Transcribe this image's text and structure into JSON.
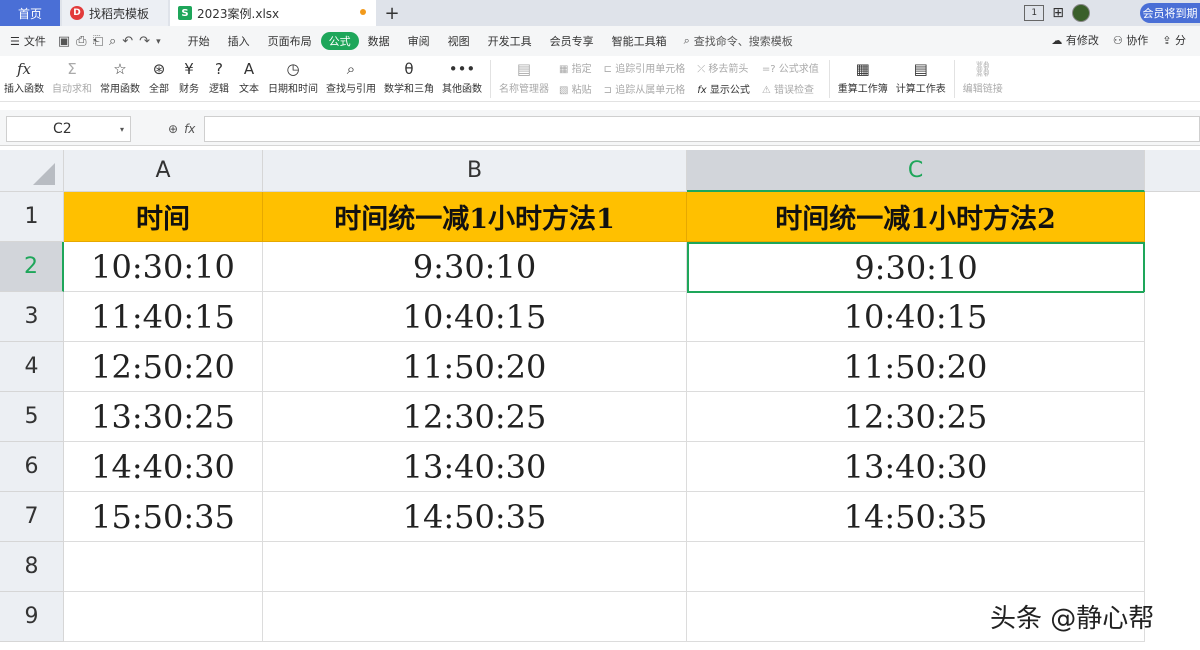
{
  "tabs": {
    "home": "首页",
    "template": "找稻壳模板",
    "file": "2023案例.xlsx",
    "add": "+"
  },
  "titlebar": {
    "page_indicator": "1",
    "vip_label": "会员将到期"
  },
  "menubar": {
    "file_label": "文件",
    "items": [
      "开始",
      "插入",
      "页面布局",
      "公式",
      "数据",
      "审阅",
      "视图",
      "开发工具",
      "会员专享",
      "智能工具箱"
    ],
    "active_index": 3,
    "search_label": "查找命令、搜索模板",
    "changes_label": "有修改",
    "collab_label": "协作",
    "share_label": "分"
  },
  "ribbon": {
    "insert_function": "插入函数",
    "auto_sum": "自动求和",
    "common_functions": "常用函数",
    "all": "全部",
    "finance": "财务",
    "logic": "逻辑",
    "text": "文本",
    "datetime": "日期和时间",
    "lookup": "查找与引用",
    "math": "数学和三角",
    "other": "其他函数",
    "name_manager": "名称管理器",
    "assign": "指定",
    "paste": "粘贴",
    "trace_precedents": "追踪引用单元格",
    "trace_dependents": "追踪从属单元格",
    "remove_arrows": "移去箭头",
    "show_formulas": "显示公式",
    "formula_eval": "公式求值",
    "error_check": "错误检查",
    "recalc_workbook": "重算工作簿",
    "calc_sheet": "计算工作表",
    "edit_links": "编辑链接"
  },
  "formula_bar": {
    "name_box": "C2",
    "fx_label": "fx",
    "formula": ""
  },
  "sheet": {
    "columns": [
      "A",
      "B",
      "C"
    ],
    "rows": [
      "1",
      "2",
      "3",
      "4",
      "5",
      "6",
      "7",
      "8",
      "9"
    ],
    "header": [
      "时间",
      "时间统一减1小时方法1",
      "时间统一减1小时方法2"
    ],
    "data": [
      [
        "10:30:10",
        "9:30:10",
        "9:30:10"
      ],
      [
        "11:40:15",
        "10:40:15",
        "10:40:15"
      ],
      [
        "12:50:20",
        "11:50:20",
        "11:50:20"
      ],
      [
        "13:30:25",
        "12:30:25",
        "12:30:25"
      ],
      [
        "14:40:30",
        "13:40:30",
        "13:40:30"
      ],
      [
        "15:50:35",
        "14:50:35",
        "14:50:35"
      ]
    ],
    "selected_column": "C",
    "selected_row": "2",
    "header_fill": "#ffc000",
    "accent": "#1ea65a"
  },
  "watermark": "头条 @静心帮"
}
